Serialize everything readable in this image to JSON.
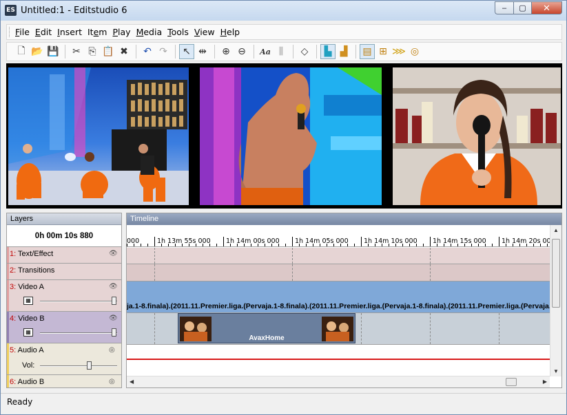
{
  "window": {
    "title": "Untitled:1 - Editstudio 6",
    "app_icon_text": "ES",
    "minimize": "–",
    "maximize": "▢",
    "close": "✕"
  },
  "menu": [
    {
      "pre": "",
      "u": "F",
      "post": "ile"
    },
    {
      "pre": "",
      "u": "E",
      "post": "dit"
    },
    {
      "pre": "",
      "u": "I",
      "post": "nsert"
    },
    {
      "pre": "It",
      "u": "e",
      "post": "m"
    },
    {
      "pre": "",
      "u": "P",
      "post": "lay"
    },
    {
      "pre": "",
      "u": "M",
      "post": "edia"
    },
    {
      "pre": "",
      "u": "T",
      "post": "ools"
    },
    {
      "pre": "",
      "u": "V",
      "post": "iew"
    },
    {
      "pre": "",
      "u": "H",
      "post": "elp"
    }
  ],
  "toolbar": {
    "icons": [
      "new-icon",
      "open-icon",
      "save-icon",
      "cut-icon",
      "copy-icon",
      "paste-icon",
      "delete-icon",
      "undo-icon",
      "redo-icon",
      "pointer-icon",
      "select-range-icon",
      "zoom-in-icon",
      "zoom-out-icon",
      "text-icon",
      "align-icon",
      "keyframe-icon",
      "snap-icon",
      "ripple-icon",
      "film-icon",
      "marker-icon",
      "transition-icon",
      "target-icon"
    ],
    "glyphs": {
      "new": "🗋",
      "open": "📂",
      "save": "💾",
      "cut": "✂",
      "copy": "⎘",
      "paste": "📋",
      "delete": "✖",
      "undo": "↶",
      "redo": "↷",
      "pointer": "↖",
      "range": "⇹",
      "zoom_in": "⊕",
      "zoom_out": "⊖",
      "text": "Aa",
      "align": "⫼",
      "keyframe": "◇",
      "snap": "▙",
      "ripple": "▟",
      "film": "▤",
      "marker": "⊞",
      "transition": "⋙",
      "target": "◎"
    }
  },
  "layers": {
    "header": "Layers",
    "timecode": "0h 00m 10s 880",
    "items": [
      {
        "num": "1:",
        "name": "Text/Effect",
        "color": "#e8c8c8"
      },
      {
        "num": "2:",
        "name": "Transitions",
        "color": "#e8c8c8"
      },
      {
        "num": "3:",
        "name": "Video A",
        "color": "#e8c8c8"
      },
      {
        "num": "4:",
        "name": "Video B",
        "color": "#b8a8c8"
      },
      {
        "num": "5:",
        "name": "Audio A",
        "color": "#f0e0a0"
      },
      {
        "num": "6:",
        "name": "Audio B",
        "color": "#f0e0a0"
      }
    ],
    "vol_label": "Vol:",
    "eye_glyph": "👁",
    "speaker_glyph": "◎"
  },
  "timeline": {
    "header": "Timeline",
    "ruler_labels": [
      "000",
      "1h 13m 55s 000",
      "1h 14m 00s 000",
      "1h 14m 05s 000",
      "1h 14m 10s 000",
      "1h 14m 15s 000",
      "1h 14m 20s 000"
    ],
    "video_a_text": "ja.1-8.finala).(2011.11.Premier.liga.(Pervaja.1-8.finala).(2011.11.Premier.liga.(Pervaja.1-8.finala).(2011.11.Premier.liga.(Pervaja.1-8.finala).(2011.11.Premier.liga.(Perva",
    "video_b_label": "AvaxHome",
    "colors": {
      "text_effect": "#e6d4d4",
      "transitions": "#dcc8c8",
      "video_a": "#7fa8d8",
      "video_b": "#c8d0d8",
      "audio_a": "#ffffff",
      "audio_line": "#d81818"
    }
  },
  "status": {
    "text": "Ready"
  }
}
